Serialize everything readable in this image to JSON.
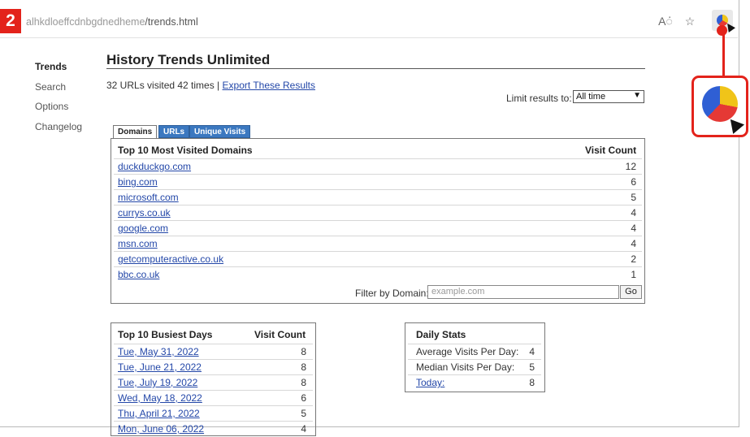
{
  "browser": {
    "url_dim": "alhkdloeffcdnbgdnedheme",
    "url_path": "/trends.html",
    "read_aloud_icon": "Aं",
    "favorites_icon": "☆"
  },
  "step_badge": "2",
  "sidebar": {
    "items": [
      {
        "label": "Trends"
      },
      {
        "label": "Search"
      },
      {
        "label": "Options"
      },
      {
        "label": "Changelog"
      }
    ]
  },
  "main": {
    "title": "History Trends Unlimited",
    "summary_text": "32 URLs visited 42 times | ",
    "export_link": "Export These Results",
    "limit_label": "Limit results to:",
    "limit_value": "All time"
  },
  "tabs": [
    {
      "label": "Domains"
    },
    {
      "label": "URLs"
    },
    {
      "label": "Unique Visits"
    }
  ],
  "domains_table": {
    "header": "Top 10 Most Visited Domains",
    "count_header": "Visit Count",
    "rows": [
      {
        "domain": "duckduckgo.com",
        "count": "12"
      },
      {
        "domain": "bing.com",
        "count": "6"
      },
      {
        "domain": "microsoft.com",
        "count": "5"
      },
      {
        "domain": "currys.co.uk",
        "count": "4"
      },
      {
        "domain": "google.com",
        "count": "4"
      },
      {
        "domain": "msn.com",
        "count": "4"
      },
      {
        "domain": "getcomputeractive.co.uk",
        "count": "2"
      },
      {
        "domain": "bbc.co.uk",
        "count": "1"
      }
    ],
    "filter_label": "Filter by Domain:",
    "filter_placeholder": "example.com",
    "go_label": "Go"
  },
  "days_table": {
    "header": "Top 10 Busiest Days",
    "count_header": "Visit Count",
    "rows": [
      {
        "day": "Tue, May 31, 2022",
        "count": "8"
      },
      {
        "day": "Tue, June 21, 2022",
        "count": "8"
      },
      {
        "day": "Tue, July 19, 2022",
        "count": "8"
      },
      {
        "day": "Wed, May 18, 2022",
        "count": "6"
      },
      {
        "day": "Thu, April 21, 2022",
        "count": "5"
      },
      {
        "day": "Mon, June 06, 2022",
        "count": "4"
      }
    ]
  },
  "daily_stats": {
    "header": "Daily Stats",
    "rows": [
      {
        "label": "Average Visits Per Day:",
        "value": "4"
      },
      {
        "label": "Median Visits Per Day:",
        "value": "5"
      },
      {
        "label": "Today:",
        "value": "8"
      }
    ]
  },
  "colors": {
    "accent_red": "#e3231b",
    "tab_blue": "#3b78c0",
    "link_blue": "#2347a8",
    "pie_yellow": "#f0c419",
    "pie_red": "#e53935",
    "pie_blue": "#2f5fd4"
  }
}
